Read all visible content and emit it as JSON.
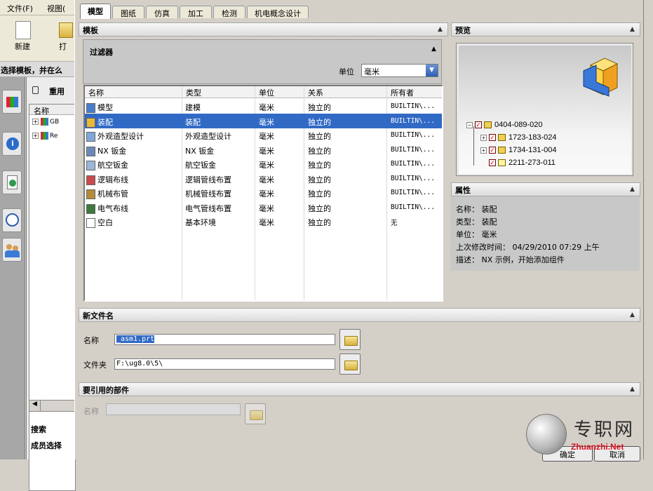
{
  "main_window": {
    "menu": [
      "文件(F)",
      "视图("
    ],
    "toolbar": {
      "new_label": "新建",
      "open_label": "打"
    },
    "status_text": "选择模板，并在么",
    "nav_panel": {
      "title": "重用",
      "list_header": "名称",
      "items": [
        "GB",
        "Re"
      ],
      "bottom_labels": [
        "搜索",
        "成员选择"
      ]
    }
  },
  "dialog": {
    "tabs": [
      "模型",
      "图纸",
      "仿真",
      "加工",
      "检测",
      "机电概念设计"
    ],
    "active_tab": "模型",
    "template_section": "模板",
    "filter": {
      "title": "过滤器",
      "unit_label": "单位",
      "unit_value": "毫米"
    },
    "table": {
      "columns": [
        "名称",
        "类型",
        "单位",
        "关系",
        "所有者"
      ],
      "rows": [
        {
          "name": "模型",
          "type": "建模",
          "unit": "毫米",
          "relation": "独立的",
          "owner": "BUILTIN\\..."
        },
        {
          "name": "装配",
          "type": "装配",
          "unit": "毫米",
          "relation": "独立的",
          "owner": "BUILTIN\\..."
        },
        {
          "name": "外观造型设计",
          "type": "外观造型设计",
          "unit": "毫米",
          "relation": "独立的",
          "owner": "BUILTIN\\..."
        },
        {
          "name": "NX 钣金",
          "type": "NX 钣金",
          "unit": "毫米",
          "relation": "独立的",
          "owner": "BUILTIN\\..."
        },
        {
          "name": "航空钣金",
          "type": "航空钣金",
          "unit": "毫米",
          "relation": "独立的",
          "owner": "BUILTIN\\..."
        },
        {
          "name": "逻辑布线",
          "type": "逻辑管线布置",
          "unit": "毫米",
          "relation": "独立的",
          "owner": "BUILTIN\\..."
        },
        {
          "name": "机械布管",
          "type": "机械管线布置",
          "unit": "毫米",
          "relation": "独立的",
          "owner": "BUILTIN\\..."
        },
        {
          "name": "电气布线",
          "type": "电气管线布置",
          "unit": "毫米",
          "relation": "独立的",
          "owner": "BUILTIN\\..."
        },
        {
          "name": "空白",
          "type": "基本环境",
          "unit": "毫米",
          "relation": "独立的",
          "owner": "无"
        }
      ],
      "selected_index": 1
    },
    "preview": {
      "title": "预览",
      "tree": [
        "0404-089-020",
        "1723-183-024",
        "1734-131-004",
        "2211-273-011"
      ]
    },
    "properties": {
      "title": "属性",
      "name": "名称： 装配",
      "type": "类型： 装配",
      "unit": "单位： 毫米",
      "modified": "上次修改时间： 04/29/2010 07:29 上午",
      "desc": "描述： NX 示例，开始添加组件"
    },
    "new_file": {
      "title": "新文件名",
      "name_label": "名称",
      "name_value": "_asm1.prt",
      "folder_label": "文件夹",
      "folder_value": "F:\\ug8.0\\5\\"
    },
    "referenced_part": {
      "title": "要引用的部件",
      "name_label": "名称"
    },
    "buttons": {
      "ok": "确定",
      "cancel": "取消"
    }
  },
  "watermark": {
    "cn": "专职网",
    "url": "Zhuanzhi.Net"
  },
  "colors": {
    "selection": "#316ac5",
    "dialog_bg": "#d4d0c8"
  }
}
